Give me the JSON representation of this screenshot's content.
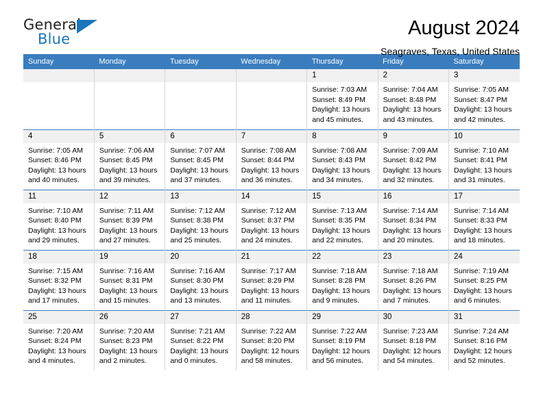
{
  "brand": {
    "name_top": "General",
    "name_bottom": "Blue",
    "accent_color": "#1b75bc",
    "flag_icon": "triangle-flag-icon"
  },
  "header": {
    "month_title": "August 2024",
    "location": "Seagraves, Texas, United States"
  },
  "theme": {
    "header_blue": "#3a7dbf",
    "daynum_background": "#f0f0f0",
    "cell_border": "#d4d4d4"
  },
  "weekdays": [
    "Sunday",
    "Monday",
    "Tuesday",
    "Wednesday",
    "Thursday",
    "Friday",
    "Saturday"
  ],
  "labels": {
    "sunrise_prefix": "Sunrise:",
    "sunset_prefix": "Sunset:",
    "daylight_prefix": "Daylight:"
  },
  "weeks": [
    [
      {
        "day": "",
        "l1": "",
        "l2": "",
        "l3": "",
        "l4": ""
      },
      {
        "day": "",
        "l1": "",
        "l2": "",
        "l3": "",
        "l4": ""
      },
      {
        "day": "",
        "l1": "",
        "l2": "",
        "l3": "",
        "l4": ""
      },
      {
        "day": "",
        "l1": "",
        "l2": "",
        "l3": "",
        "l4": ""
      },
      {
        "day": "1",
        "l1": "Sunrise: 7:03 AM",
        "l2": "Sunset: 8:49 PM",
        "l3": "Daylight: 13 hours",
        "l4": "and 45 minutes."
      },
      {
        "day": "2",
        "l1": "Sunrise: 7:04 AM",
        "l2": "Sunset: 8:48 PM",
        "l3": "Daylight: 13 hours",
        "l4": "and 43 minutes."
      },
      {
        "day": "3",
        "l1": "Sunrise: 7:05 AM",
        "l2": "Sunset: 8:47 PM",
        "l3": "Daylight: 13 hours",
        "l4": "and 42 minutes."
      }
    ],
    [
      {
        "day": "4",
        "l1": "Sunrise: 7:05 AM",
        "l2": "Sunset: 8:46 PM",
        "l3": "Daylight: 13 hours",
        "l4": "and 40 minutes."
      },
      {
        "day": "5",
        "l1": "Sunrise: 7:06 AM",
        "l2": "Sunset: 8:45 PM",
        "l3": "Daylight: 13 hours",
        "l4": "and 39 minutes."
      },
      {
        "day": "6",
        "l1": "Sunrise: 7:07 AM",
        "l2": "Sunset: 8:45 PM",
        "l3": "Daylight: 13 hours",
        "l4": "and 37 minutes."
      },
      {
        "day": "7",
        "l1": "Sunrise: 7:08 AM",
        "l2": "Sunset: 8:44 PM",
        "l3": "Daylight: 13 hours",
        "l4": "and 36 minutes."
      },
      {
        "day": "8",
        "l1": "Sunrise: 7:08 AM",
        "l2": "Sunset: 8:43 PM",
        "l3": "Daylight: 13 hours",
        "l4": "and 34 minutes."
      },
      {
        "day": "9",
        "l1": "Sunrise: 7:09 AM",
        "l2": "Sunset: 8:42 PM",
        "l3": "Daylight: 13 hours",
        "l4": "and 32 minutes."
      },
      {
        "day": "10",
        "l1": "Sunrise: 7:10 AM",
        "l2": "Sunset: 8:41 PM",
        "l3": "Daylight: 13 hours",
        "l4": "and 31 minutes."
      }
    ],
    [
      {
        "day": "11",
        "l1": "Sunrise: 7:10 AM",
        "l2": "Sunset: 8:40 PM",
        "l3": "Daylight: 13 hours",
        "l4": "and 29 minutes."
      },
      {
        "day": "12",
        "l1": "Sunrise: 7:11 AM",
        "l2": "Sunset: 8:39 PM",
        "l3": "Daylight: 13 hours",
        "l4": "and 27 minutes."
      },
      {
        "day": "13",
        "l1": "Sunrise: 7:12 AM",
        "l2": "Sunset: 8:38 PM",
        "l3": "Daylight: 13 hours",
        "l4": "and 25 minutes."
      },
      {
        "day": "14",
        "l1": "Sunrise: 7:12 AM",
        "l2": "Sunset: 8:37 PM",
        "l3": "Daylight: 13 hours",
        "l4": "and 24 minutes."
      },
      {
        "day": "15",
        "l1": "Sunrise: 7:13 AM",
        "l2": "Sunset: 8:35 PM",
        "l3": "Daylight: 13 hours",
        "l4": "and 22 minutes."
      },
      {
        "day": "16",
        "l1": "Sunrise: 7:14 AM",
        "l2": "Sunset: 8:34 PM",
        "l3": "Daylight: 13 hours",
        "l4": "and 20 minutes."
      },
      {
        "day": "17",
        "l1": "Sunrise: 7:14 AM",
        "l2": "Sunset: 8:33 PM",
        "l3": "Daylight: 13 hours",
        "l4": "and 18 minutes."
      }
    ],
    [
      {
        "day": "18",
        "l1": "Sunrise: 7:15 AM",
        "l2": "Sunset: 8:32 PM",
        "l3": "Daylight: 13 hours",
        "l4": "and 17 minutes."
      },
      {
        "day": "19",
        "l1": "Sunrise: 7:16 AM",
        "l2": "Sunset: 8:31 PM",
        "l3": "Daylight: 13 hours",
        "l4": "and 15 minutes."
      },
      {
        "day": "20",
        "l1": "Sunrise: 7:16 AM",
        "l2": "Sunset: 8:30 PM",
        "l3": "Daylight: 13 hours",
        "l4": "and 13 minutes."
      },
      {
        "day": "21",
        "l1": "Sunrise: 7:17 AM",
        "l2": "Sunset: 8:29 PM",
        "l3": "Daylight: 13 hours",
        "l4": "and 11 minutes."
      },
      {
        "day": "22",
        "l1": "Sunrise: 7:18 AM",
        "l2": "Sunset: 8:28 PM",
        "l3": "Daylight: 13 hours",
        "l4": "and 9 minutes."
      },
      {
        "day": "23",
        "l1": "Sunrise: 7:18 AM",
        "l2": "Sunset: 8:26 PM",
        "l3": "Daylight: 13 hours",
        "l4": "and 7 minutes."
      },
      {
        "day": "24",
        "l1": "Sunrise: 7:19 AM",
        "l2": "Sunset: 8:25 PM",
        "l3": "Daylight: 13 hours",
        "l4": "and 6 minutes."
      }
    ],
    [
      {
        "day": "25",
        "l1": "Sunrise: 7:20 AM",
        "l2": "Sunset: 8:24 PM",
        "l3": "Daylight: 13 hours",
        "l4": "and 4 minutes."
      },
      {
        "day": "26",
        "l1": "Sunrise: 7:20 AM",
        "l2": "Sunset: 8:23 PM",
        "l3": "Daylight: 13 hours",
        "l4": "and 2 minutes."
      },
      {
        "day": "27",
        "l1": "Sunrise: 7:21 AM",
        "l2": "Sunset: 8:22 PM",
        "l3": "Daylight: 13 hours",
        "l4": "and 0 minutes."
      },
      {
        "day": "28",
        "l1": "Sunrise: 7:22 AM",
        "l2": "Sunset: 8:20 PM",
        "l3": "Daylight: 12 hours",
        "l4": "and 58 minutes."
      },
      {
        "day": "29",
        "l1": "Sunrise: 7:22 AM",
        "l2": "Sunset: 8:19 PM",
        "l3": "Daylight: 12 hours",
        "l4": "and 56 minutes."
      },
      {
        "day": "30",
        "l1": "Sunrise: 7:23 AM",
        "l2": "Sunset: 8:18 PM",
        "l3": "Daylight: 12 hours",
        "l4": "and 54 minutes."
      },
      {
        "day": "31",
        "l1": "Sunrise: 7:24 AM",
        "l2": "Sunset: 8:16 PM",
        "l3": "Daylight: 12 hours",
        "l4": "and 52 minutes."
      }
    ]
  ]
}
